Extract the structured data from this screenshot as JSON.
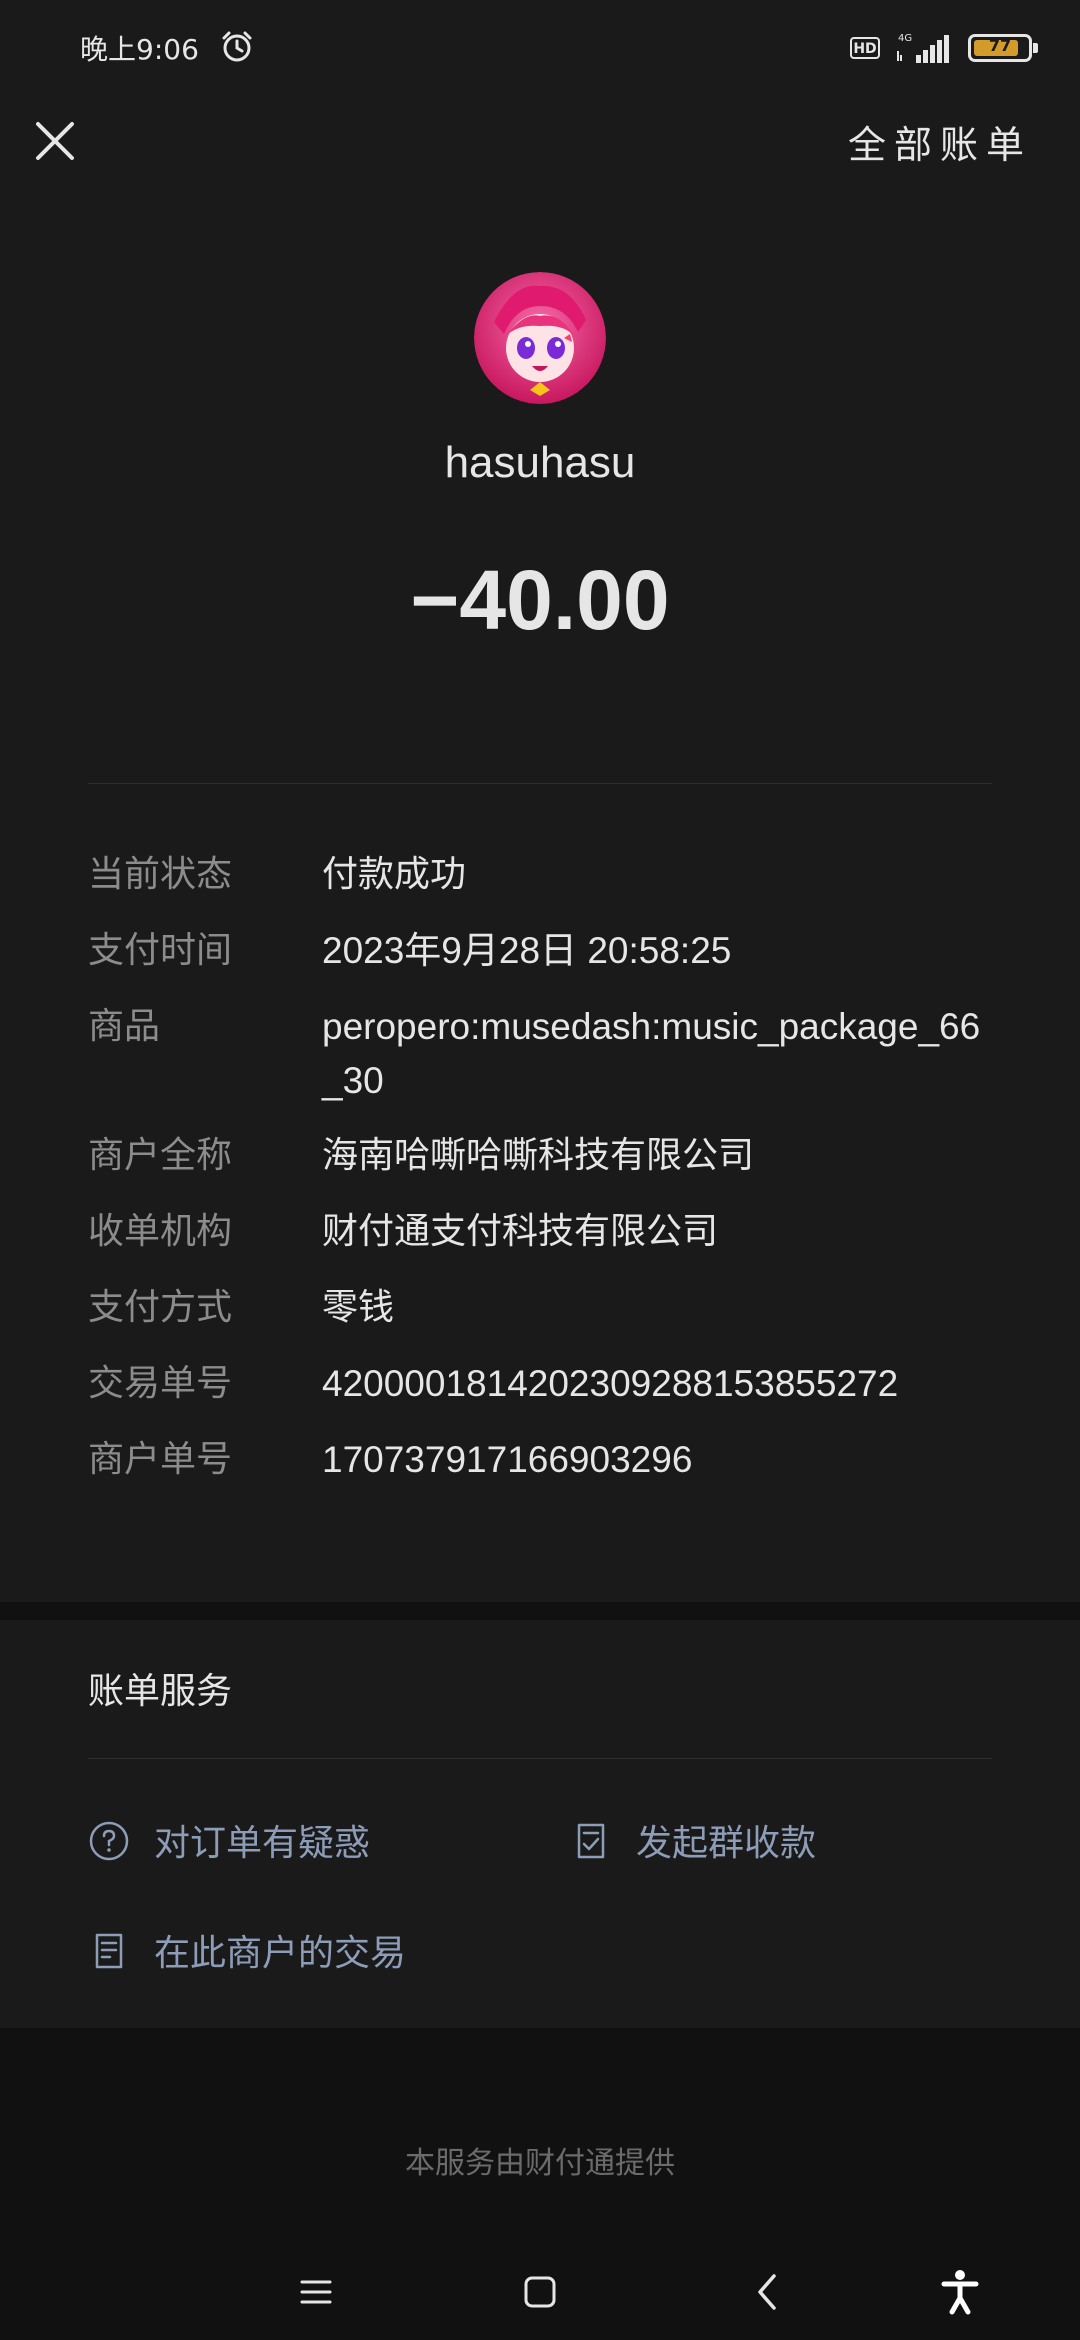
{
  "status_bar": {
    "time": "晚上9:06",
    "hd_label": "HD",
    "network": "4G",
    "battery_level": "77"
  },
  "header": {
    "close_icon": "close-icon",
    "all_bills_label": "全部账单"
  },
  "payee": {
    "name": "hasuhasu",
    "amount": "−40.00"
  },
  "details": [
    {
      "label": "当前状态",
      "value": "付款成功"
    },
    {
      "label": "支付时间",
      "value": "2023年9月28日 20:58:25"
    },
    {
      "label": "商品",
      "value": "peropero:musedash:music_package_66_30"
    },
    {
      "label": "商户全称",
      "value": "海南哈嘶哈嘶科技有限公司"
    },
    {
      "label": "收单机构",
      "value": "财付通支付科技有限公司"
    },
    {
      "label": "支付方式",
      "value": "零钱"
    },
    {
      "label": "交易单号",
      "value": "4200001814202309288153855272"
    },
    {
      "label": "商户单号",
      "value": "170737917166903296"
    }
  ],
  "services": {
    "title": "账单服务",
    "items": [
      {
        "label": "对订单有疑惑",
        "icon": "question-circle-icon"
      },
      {
        "label": "发起群收款",
        "icon": "group-collect-icon"
      },
      {
        "label": "在此商户的交易",
        "icon": "receipt-icon"
      }
    ]
  },
  "footer": {
    "provider_text": "本服务由财付通提供"
  },
  "nav": {
    "menu_icon": "menu-icon",
    "home_icon": "home-square-icon",
    "back_icon": "back-chevron-icon",
    "accessibility_icon": "accessibility-icon"
  },
  "colors": {
    "background": "#1a1a1a",
    "label_gray": "#8c8c8c",
    "link_blue_gray": "#8d9db8",
    "avatar_pink": "#e8337d"
  }
}
